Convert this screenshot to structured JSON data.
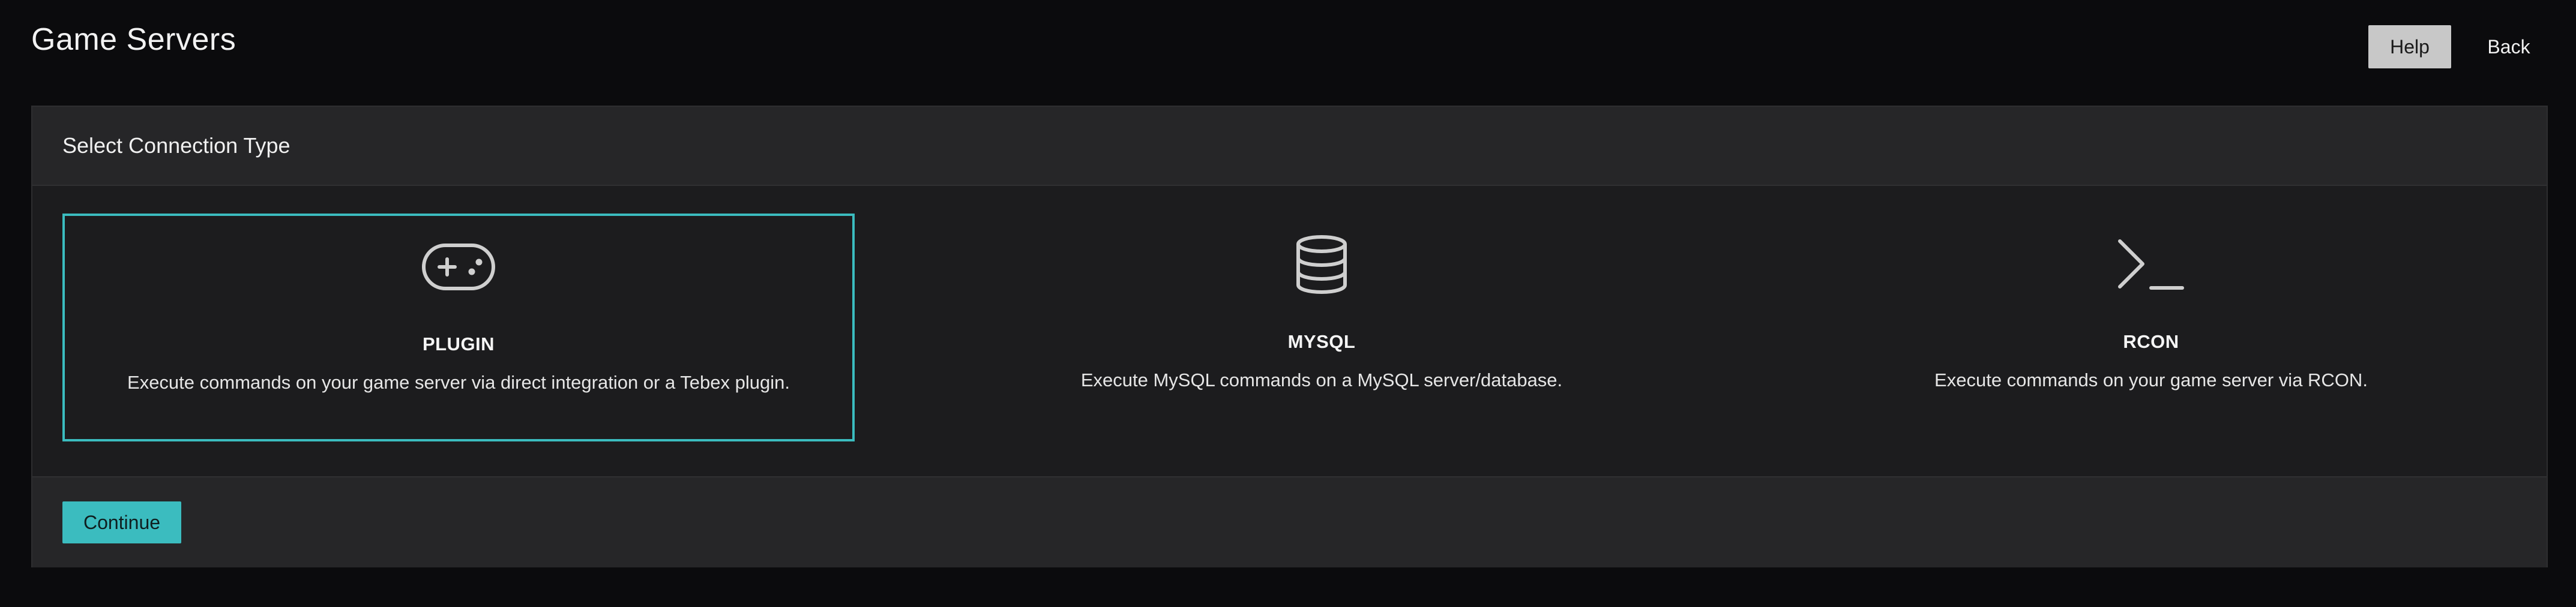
{
  "header": {
    "title": "Game Servers",
    "help_label": "Help",
    "back_label": "Back"
  },
  "panel": {
    "title": "Select Connection Type",
    "options": [
      {
        "id": "plugin",
        "icon": "gamepad-icon",
        "title": "PLUGIN",
        "description": "Execute commands on your game server via direct integration or a Tebex plugin.",
        "selected": true
      },
      {
        "id": "mysql",
        "icon": "database-icon",
        "title": "MYSQL",
        "description": "Execute MySQL commands on a MySQL server/database.",
        "selected": false
      },
      {
        "id": "rcon",
        "icon": "terminal-icon",
        "title": "RCON",
        "description": "Execute commands on your game server via RCON.",
        "selected": false
      }
    ],
    "continue_label": "Continue"
  },
  "colors": {
    "background": "#0b0b0d",
    "panel": "#1c1c1e",
    "panel_header": "#262628",
    "accent": "#3bbcbf",
    "help_button": "#c8c8c8"
  }
}
